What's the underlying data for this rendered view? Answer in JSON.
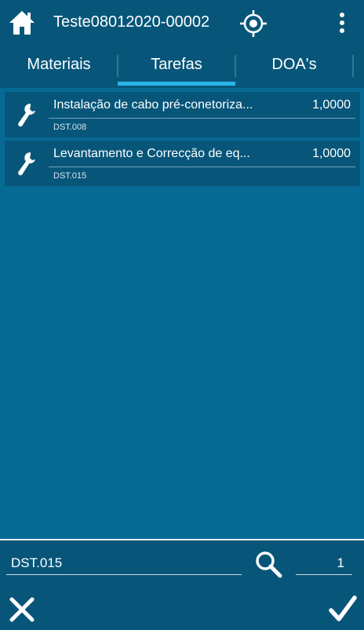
{
  "header": {
    "title": "Teste08012020-00002",
    "icons": {
      "home": "home-icon",
      "gps": "gps-target-icon",
      "more": "more-vert-icon"
    }
  },
  "tabs": [
    {
      "label": "Materiais",
      "selected": false
    },
    {
      "label": "Tarefas",
      "selected": true
    },
    {
      "label": "DOA's",
      "selected": false
    }
  ],
  "tasks": [
    {
      "name": "Instalação de cabo pré-conetoriza...",
      "quantity": "1,0000",
      "code": "DST.008",
      "icon": "wrench-icon"
    },
    {
      "name": "Levantamento e Correcção de eq...",
      "quantity": "1,0000",
      "code": "DST.015",
      "icon": "wrench-icon"
    }
  ],
  "footer": {
    "code_value": "DST.015",
    "quantity_value": "1",
    "icons": {
      "search": "search-icon",
      "cancel": "close-icon",
      "confirm": "check-icon"
    }
  },
  "colors": {
    "background": "#076a94",
    "bar": "#07567a",
    "accent": "#29b6e8"
  }
}
